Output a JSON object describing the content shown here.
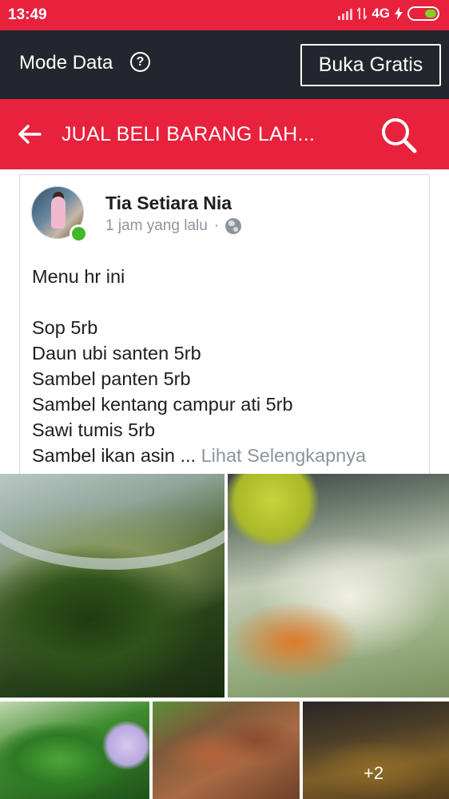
{
  "status_bar": {
    "time": "13:49",
    "network": "4G",
    "signal_bars": 4,
    "battery_level_percent": 30,
    "battery_color": "#7ed321"
  },
  "mode_bar": {
    "label": "Mode Data",
    "help_glyph": "?",
    "cta": "Buka Gratis"
  },
  "group_header": {
    "title": "JUAL BELI BARANG LAH...",
    "back_icon": "back-arrow-icon",
    "search_icon": "search-icon",
    "background": "#e8213d"
  },
  "post": {
    "author": "Tia Setiara Nia",
    "time": "1 jam yang lalu",
    "separator": "·",
    "privacy_icon": "globe-icon",
    "online_color": "#42b72a",
    "lines": [
      "Menu hr ini",
      "",
      "Sop 5rb",
      "Daun ubi santen 5rb",
      "Sambel panten 5rb",
      "Sambel kentang campur ati 5rb",
      "Sawi tumis 5rb",
      "Sambel ikan asin ..."
    ],
    "see_more": "Lihat Selengkapnya",
    "extra_photos": "+2"
  }
}
